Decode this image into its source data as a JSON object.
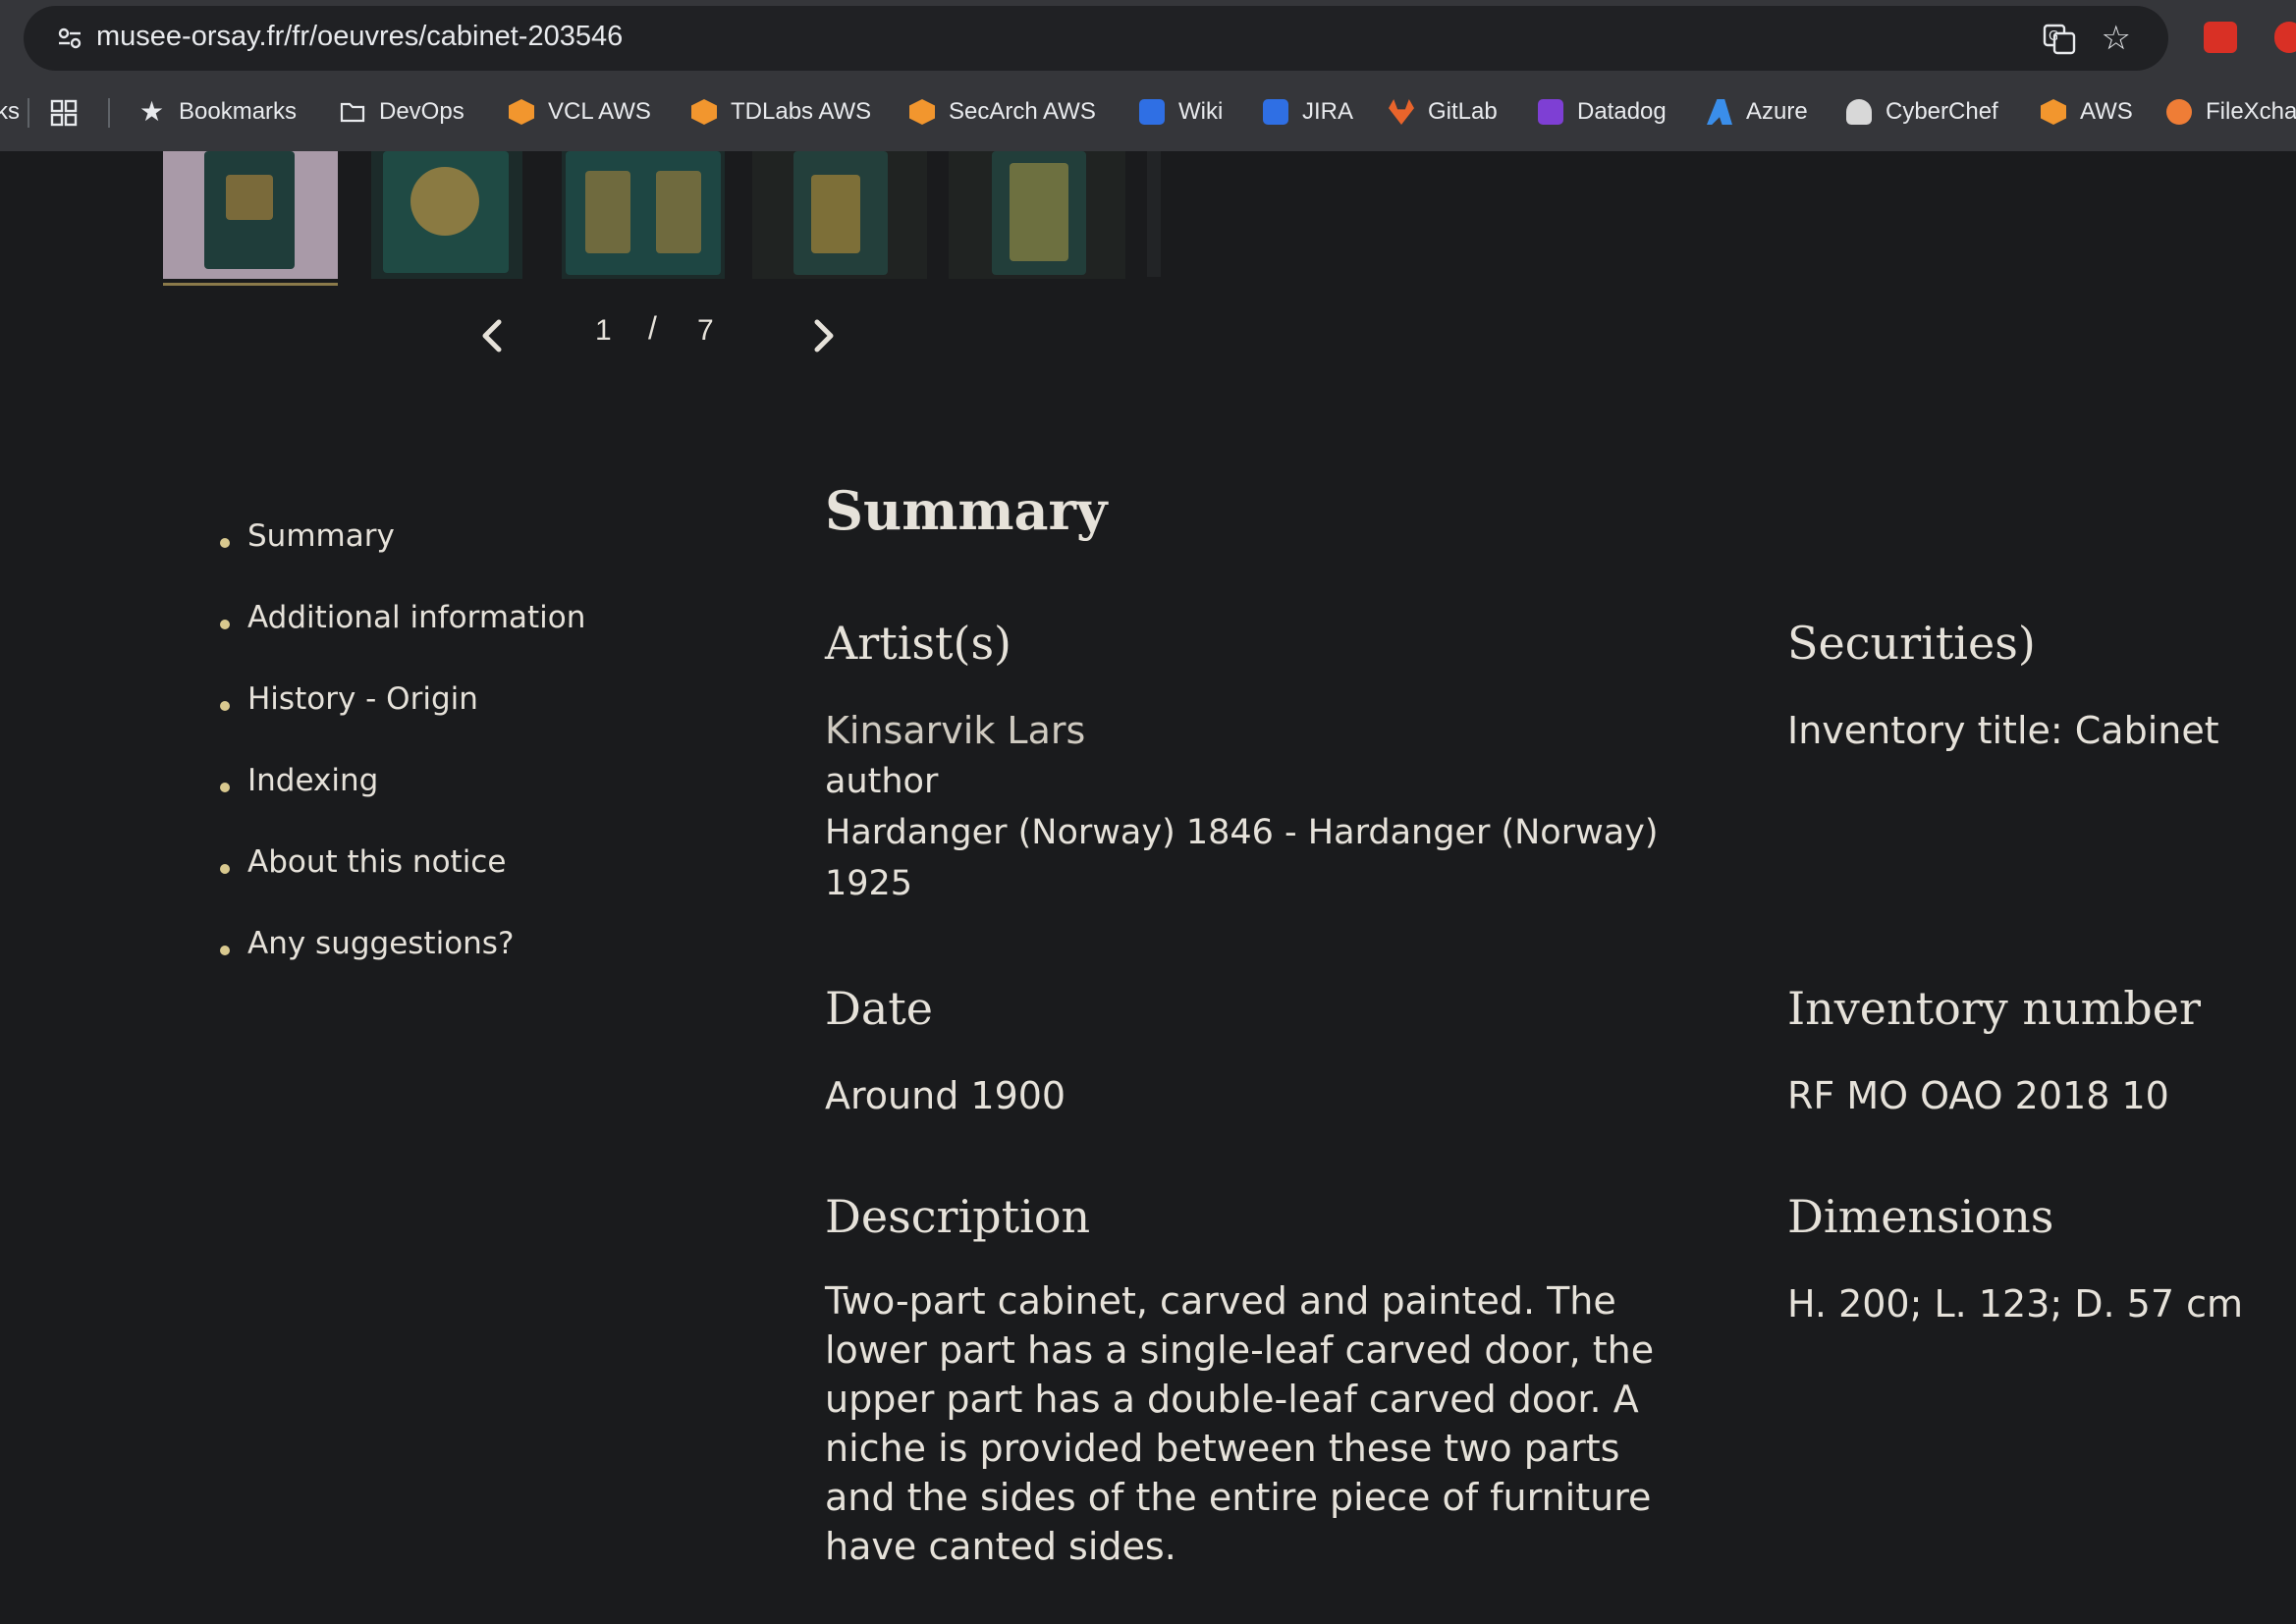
{
  "browser": {
    "url": "musee-orsay.fr/fr/oeuvres/cabinet-203546",
    "bookmarks": [
      {
        "label": "ks",
        "icon": "truncated-bookmark"
      },
      {
        "label": "",
        "icon": "apps-grid-icon"
      },
      {
        "label": "Bookmarks",
        "icon": "star-icon"
      },
      {
        "label": "DevOps",
        "icon": "folder-icon"
      },
      {
        "label": "VCL AWS",
        "icon": "aws-cube-icon"
      },
      {
        "label": "TDLabs AWS",
        "icon": "aws-cube-icon"
      },
      {
        "label": "SecArch AWS",
        "icon": "aws-cube-icon"
      },
      {
        "label": "Wiki",
        "icon": "confluence-icon"
      },
      {
        "label": "JIRA",
        "icon": "jira-icon"
      },
      {
        "label": "GitLab",
        "icon": "gitlab-icon"
      },
      {
        "label": "Datadog",
        "icon": "datadog-icon"
      },
      {
        "label": "Azure",
        "icon": "azure-icon"
      },
      {
        "label": "CyberChef",
        "icon": "cyberchef-icon"
      },
      {
        "label": "AWS",
        "icon": "aws-cube-icon"
      },
      {
        "label": "FileXcha",
        "icon": "filexchange-icon"
      }
    ]
  },
  "gallery": {
    "current_page": "1",
    "separator": "/",
    "total_pages": "7"
  },
  "toc": [
    "Summary",
    "Additional information",
    "History - Origin",
    "Indexing",
    "About this notice",
    "Any suggestions?"
  ],
  "summary": {
    "title": "Summary",
    "artists_heading": "Artist(s)",
    "artist_name": "Kinsarvik Lars",
    "artist_role": "author",
    "artist_life_line1": "Hardanger (Norway) 1846 - Hardanger (Norway)",
    "artist_life_line2": "1925",
    "securities_heading": "Securities)",
    "inventory_title": "Inventory title: Cabinet",
    "date_heading": "Date",
    "date_value": "Around 1900",
    "inventory_number_heading": "Inventory number",
    "inventory_number_value": "RF MO OAO 2018 10",
    "description_heading": "Description",
    "description_value": "Two-part cabinet, carved and painted. The lower part has a single-leaf carved door, the upper part has a double-leaf carved door. A niche is provided between these two parts and the sides of the entire piece of furniture have canted sides.",
    "dimensions_heading": "Dimensions",
    "dimensions_value": "H. 200; L. 123; D. 57 cm"
  },
  "colors": {
    "page_background": "#1a1b1d",
    "text": "#e6e2da",
    "bullet": "#d9c98f",
    "chrome": "#35363a"
  }
}
